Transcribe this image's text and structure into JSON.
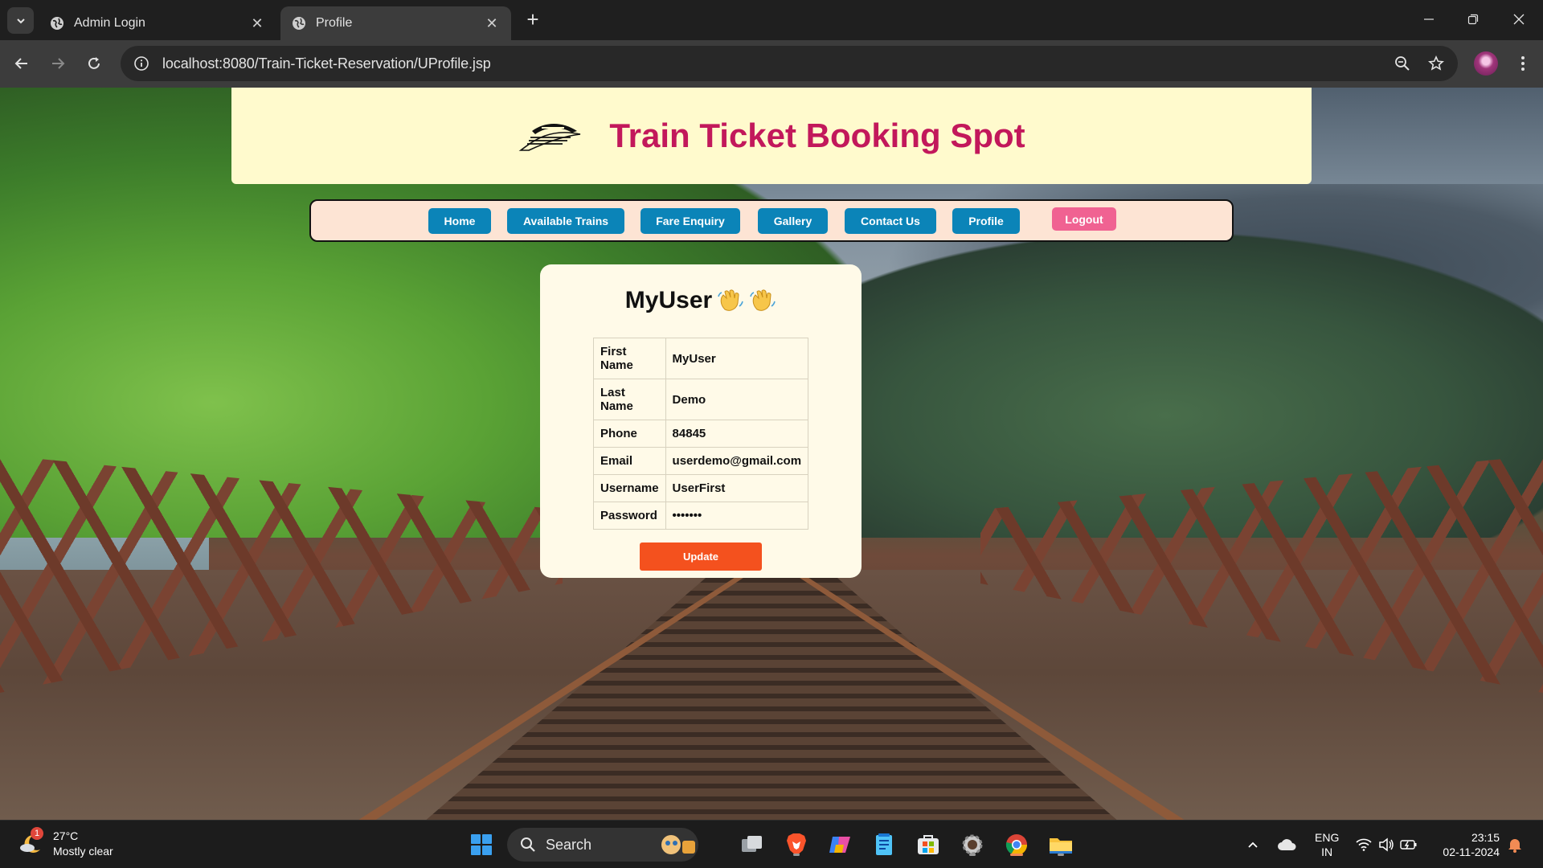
{
  "browser": {
    "tabs": [
      {
        "title": "Admin Login",
        "active": false
      },
      {
        "title": "Profile",
        "active": true
      }
    ],
    "url": "localhost:8080/Train-Ticket-Reservation/UProfile.jsp"
  },
  "site": {
    "title": "Train Ticket Booking Spot",
    "nav": [
      {
        "label": "Home"
      },
      {
        "label": "Available Trains"
      },
      {
        "label": "Fare Enquiry"
      },
      {
        "label": "Gallery"
      },
      {
        "label": "Contact Us"
      },
      {
        "label": "Profile"
      }
    ],
    "logout_label": "Logout",
    "colors": {
      "title": "#c2185b",
      "nav": "#0b84b8",
      "logout": "#f06292",
      "update": "#f4511e"
    }
  },
  "profile": {
    "heading": "MyUser",
    "rows": [
      {
        "label": "First Name",
        "value": "MyUser"
      },
      {
        "label": "Last Name",
        "value": "Demo"
      },
      {
        "label": "Phone",
        "value": "84845"
      },
      {
        "label": "Email",
        "value": "userdemo@gmail.com"
      },
      {
        "label": "Username",
        "value": "UserFirst"
      },
      {
        "label": "Password",
        "value": "•••••••"
      }
    ],
    "update_label": "Update"
  },
  "taskbar": {
    "weather": {
      "temp": "27°C",
      "desc": "Mostly clear",
      "badge": "1"
    },
    "search_label": "Search",
    "lang": {
      "line1": "ENG",
      "line2": "IN"
    },
    "clock": {
      "time": "23:15",
      "date": "02-11-2024"
    }
  }
}
